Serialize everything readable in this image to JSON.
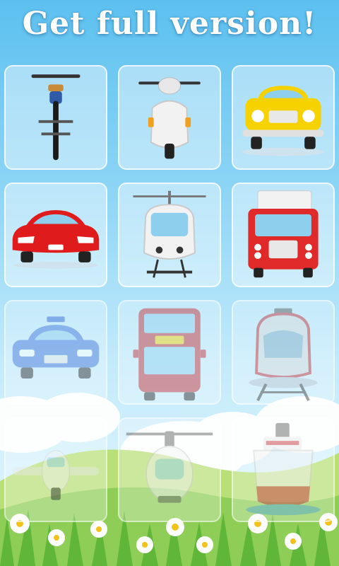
{
  "header": {
    "title": "Get full version!"
  },
  "tiles": [
    {
      "icon": "bicycle-icon",
      "locked": false
    },
    {
      "icon": "scooter-icon",
      "locked": false
    },
    {
      "icon": "taxi-icon",
      "locked": false
    },
    {
      "icon": "sports-car-icon",
      "locked": false
    },
    {
      "icon": "monorail-icon",
      "locked": false
    },
    {
      "icon": "fire-truck-icon",
      "locked": false
    },
    {
      "icon": "police-car-icon",
      "locked": true
    },
    {
      "icon": "double-decker-bus-icon",
      "locked": true
    },
    {
      "icon": "tram-icon",
      "locked": true
    },
    {
      "icon": "airplane-icon",
      "locked": true
    },
    {
      "icon": "helicopter-icon",
      "locked": true
    },
    {
      "icon": "ship-icon",
      "locked": true
    }
  ],
  "colors": {
    "sky_top": "#5cc0ef",
    "grass": "#7bc54a",
    "hills": "#9fd85f"
  }
}
